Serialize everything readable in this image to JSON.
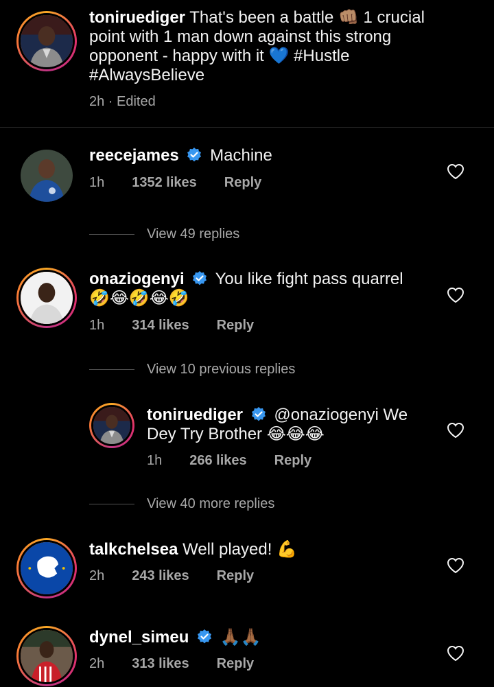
{
  "caption": {
    "username": "toniruediger",
    "text": "That's been a battle 👊🏽 1 crucial point with 1 man down against this strong opponent - happy with it 💙 #Hustle #AlwaysBelieve",
    "meta": "2h · Edited"
  },
  "comments": [
    {
      "username": "reecejames",
      "verified": true,
      "text": "Machine",
      "time": "1h",
      "likes": "1352 likes",
      "reply": "Reply",
      "view_replies": "View 49 replies"
    },
    {
      "username": "onaziogenyi",
      "verified": true,
      "text": "You like fight pass quarrel 🤣😂🤣😂🤣",
      "time": "1h",
      "likes": "314 likes",
      "reply": "Reply",
      "view_previous": "View 10 previous replies",
      "replies": [
        {
          "username": "toniruediger",
          "verified": true,
          "text": "@onaziogenyi We Dey Try Brother 😂😂😂",
          "time": "1h",
          "likes": "266 likes",
          "reply": "Reply"
        }
      ],
      "view_more": "View 40 more replies"
    },
    {
      "username": "talkchelsea",
      "verified": false,
      "text": "Well played! 💪",
      "time": "2h",
      "likes": "243 likes",
      "reply": "Reply"
    },
    {
      "username": "dynel_simeu",
      "verified": true,
      "text": "🙏🏾🙏🏾",
      "time": "2h",
      "likes": "313 likes",
      "reply": "Reply"
    }
  ],
  "colors": {
    "background": "#000000",
    "verified_badge": "#3897f0",
    "muted_text": "#a8a8a8",
    "talkchelsea_blue": "#0a47a8"
  }
}
